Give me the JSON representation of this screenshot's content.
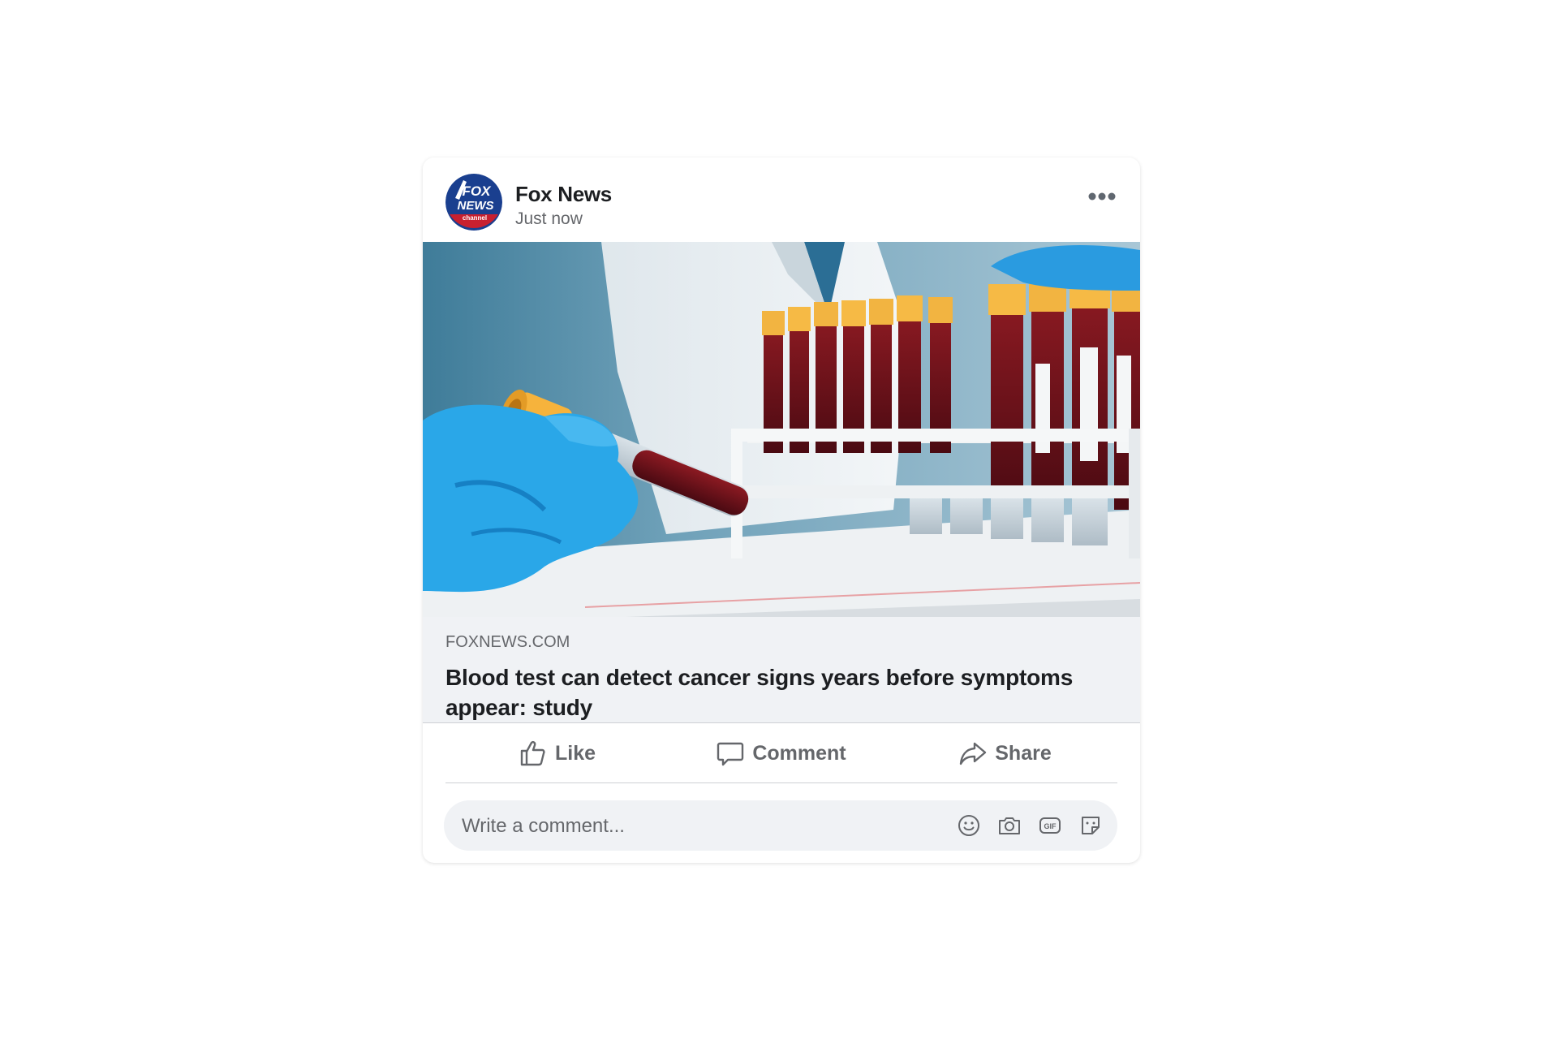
{
  "post": {
    "page_name": "Fox News",
    "timestamp": "Just now",
    "avatar": {
      "logo_text_line1": "FOX",
      "logo_text_line2": "NEWS",
      "logo_text_line3": "channel"
    },
    "more_icon": "more-horizontal-icon",
    "image_icon": "blood-test-tubes-photo"
  },
  "link_preview": {
    "domain": "FOXNEWS.COM",
    "headline": "Blood test can detect cancer signs years before symptoms appear: study"
  },
  "actions": {
    "like_label": "Like",
    "comment_label": "Comment",
    "share_label": "Share",
    "icons": [
      "thumbs-up-icon",
      "comment-bubble-icon",
      "share-arrow-icon"
    ]
  },
  "comment_box": {
    "placeholder": "Write a comment...",
    "icons": [
      "emoji-icon",
      "camera-icon",
      "gif-icon",
      "sticker-icon"
    ]
  },
  "colors": {
    "text_primary": "#1c1e21",
    "text_secondary": "#65676b",
    "preview_bg": "#f0f2f5",
    "divider": "#ced0d4",
    "fox_blue": "#1a3f8f",
    "fox_red": "#c8202f"
  }
}
